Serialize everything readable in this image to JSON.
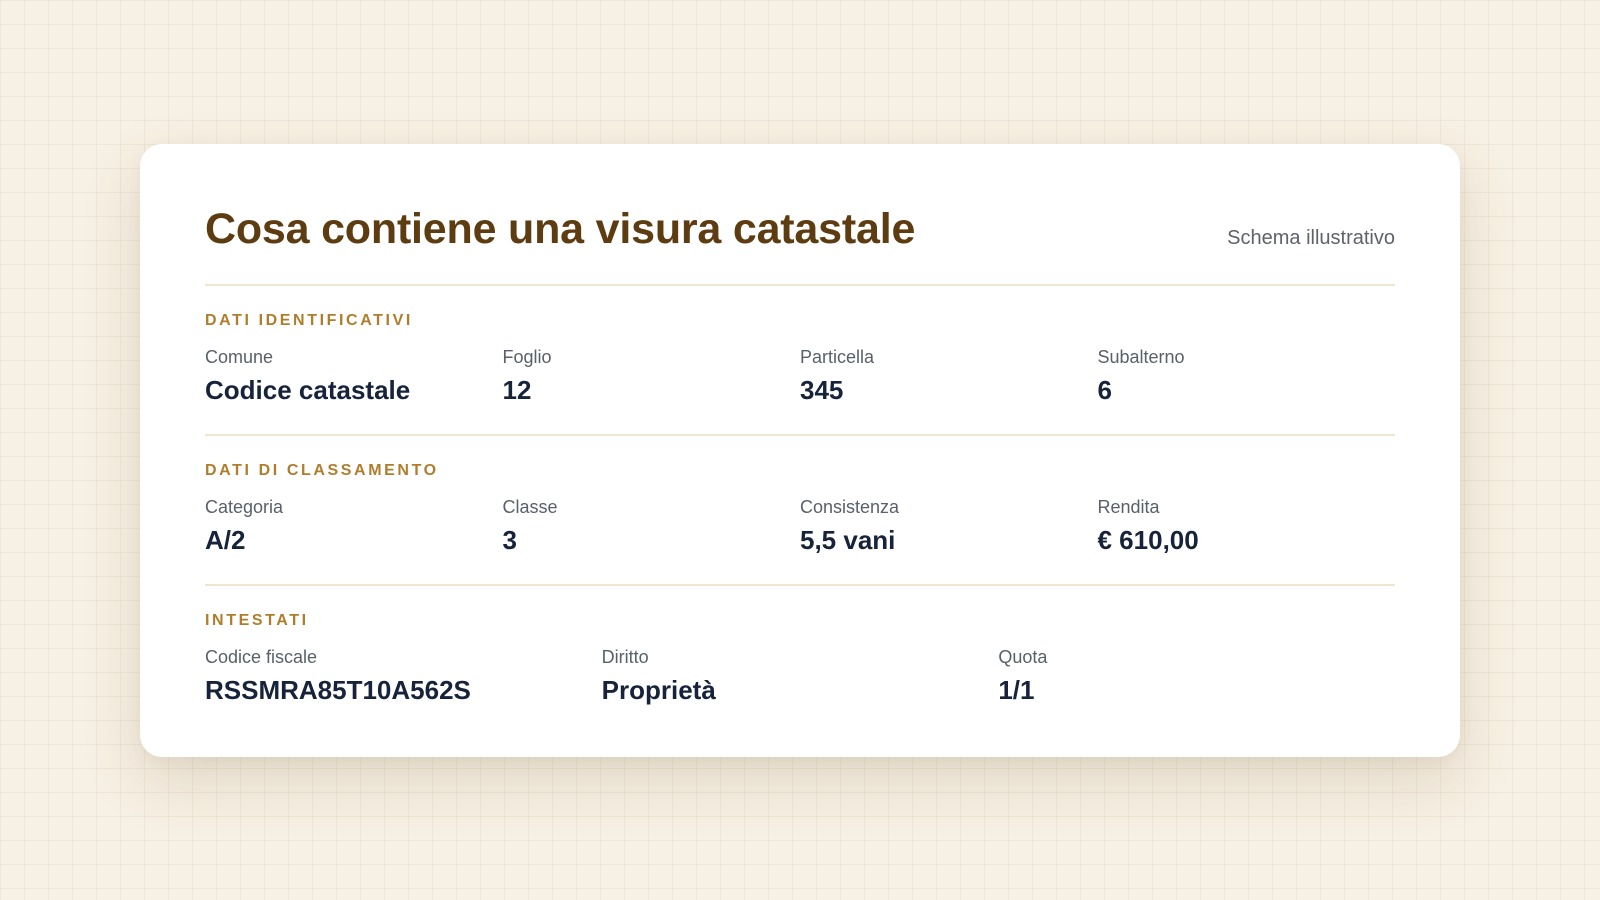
{
  "header": {
    "title": "Cosa contiene una visura catastale",
    "subtitle": "Schema illustrativo"
  },
  "sections": [
    {
      "title": "DATI IDENTIFICATIVI",
      "fields": [
        {
          "label": "Comune",
          "value": "Codice catastale"
        },
        {
          "label": "Foglio",
          "value": "12"
        },
        {
          "label": "Particella",
          "value": "345"
        },
        {
          "label": "Subalterno",
          "value": "6"
        }
      ]
    },
    {
      "title": "DATI DI CLASSAMENTO",
      "fields": [
        {
          "label": "Categoria",
          "value": "A/2"
        },
        {
          "label": "Classe",
          "value": "3"
        },
        {
          "label": "Consistenza",
          "value": "5,5 vani"
        },
        {
          "label": "Rendita",
          "value": "€ 610,00"
        }
      ]
    },
    {
      "title": "INTESTATI",
      "fields": [
        {
          "label": "Codice fiscale",
          "value": "RSSMRA85T10A562S"
        },
        {
          "label": "Diritto",
          "value": "Proprietà"
        },
        {
          "label": "Quota",
          "value": "1/1"
        }
      ]
    }
  ]
}
